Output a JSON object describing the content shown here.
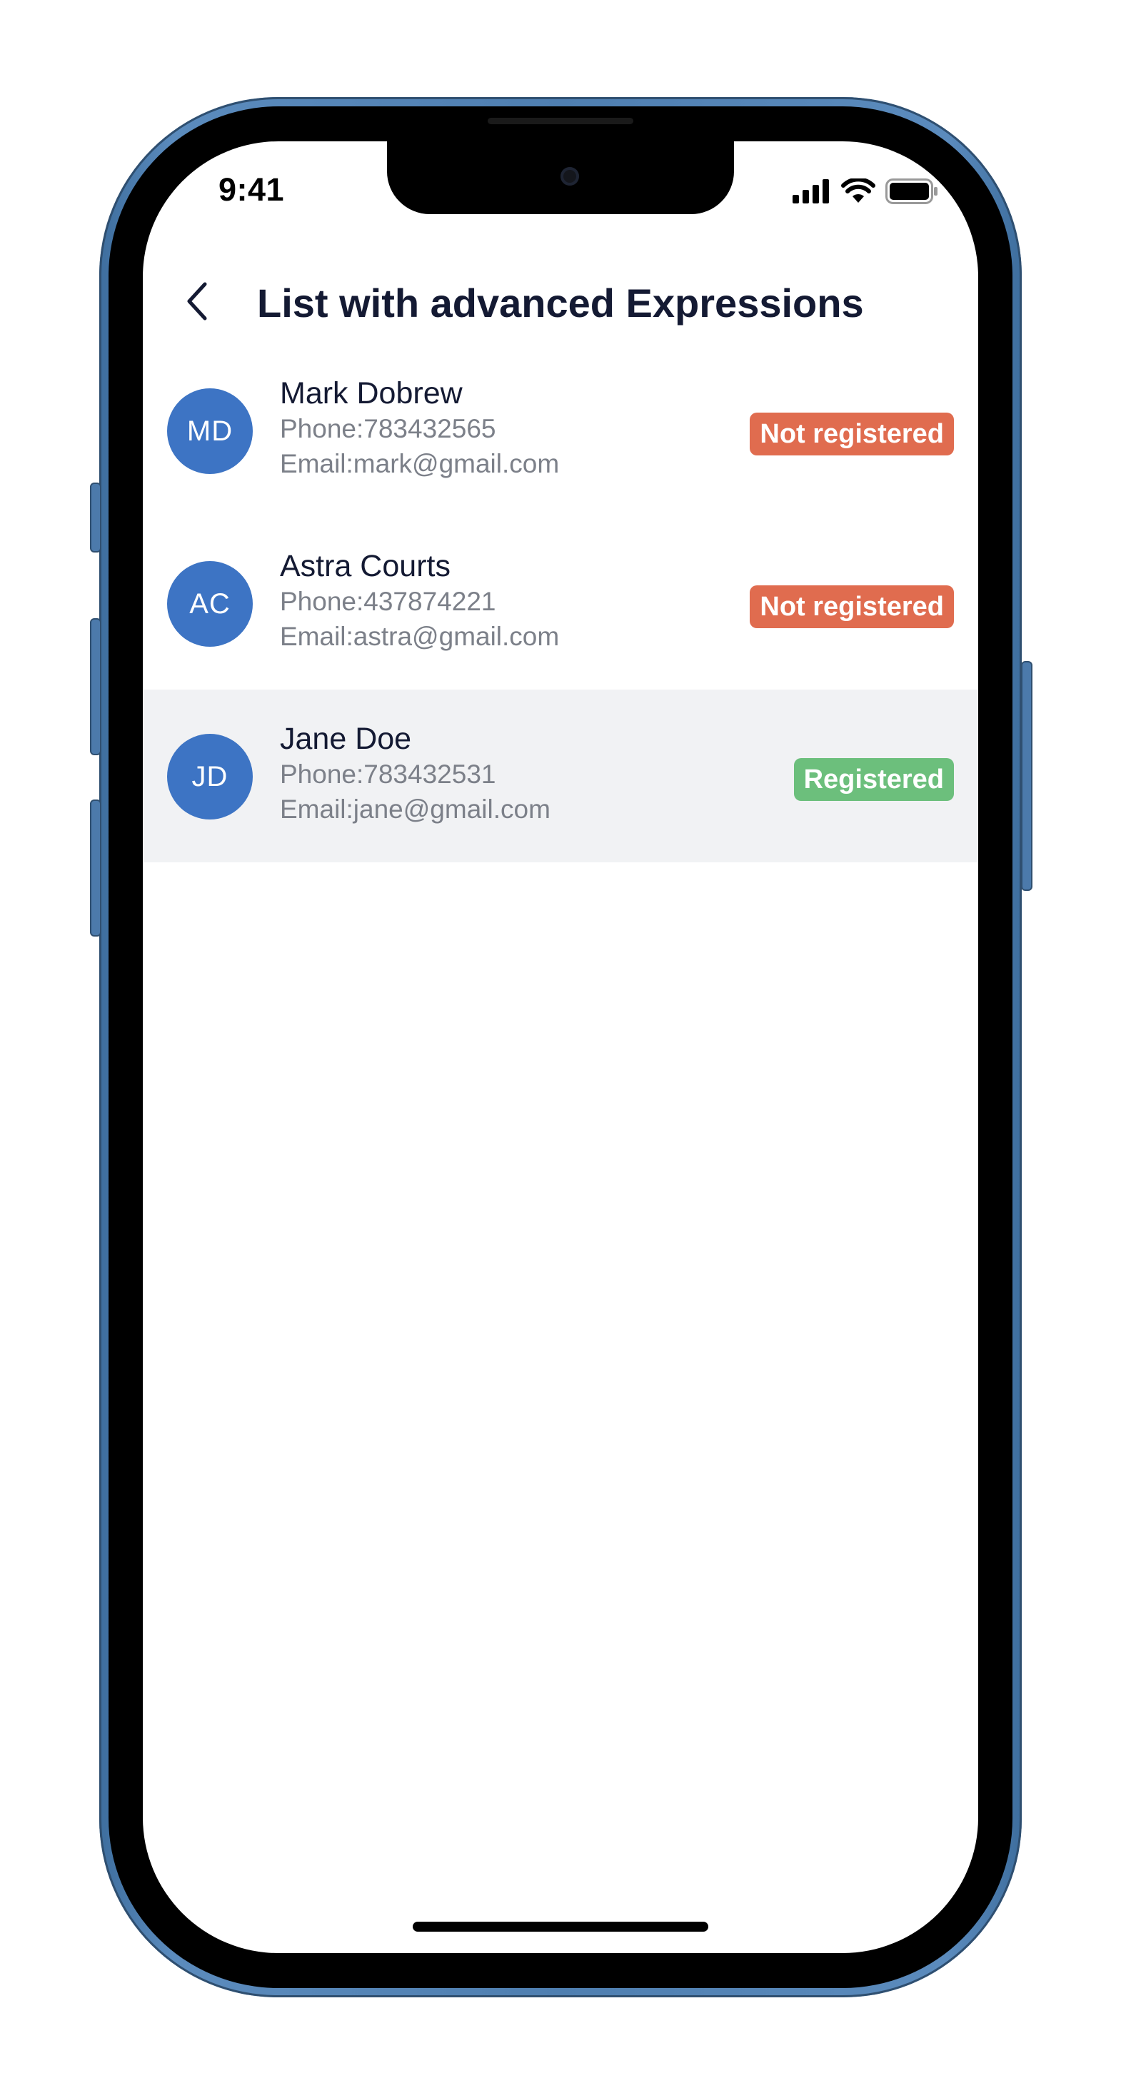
{
  "status_bar": {
    "time": "9:41"
  },
  "header": {
    "title": "List with advanced Expressions"
  },
  "contacts": [
    {
      "initials": "MD",
      "name": "Mark Dobrew",
      "phone": "Phone:783432565",
      "email": "Email:mark@gmail.com",
      "status": "Not registered",
      "status_color": "#e06c4f",
      "selected": false
    },
    {
      "initials": "AC",
      "name": "Astra Courts",
      "phone": "Phone:437874221",
      "email": "Email:astra@gmail.com",
      "status": "Not registered",
      "status_color": "#e06c4f",
      "selected": false
    },
    {
      "initials": "JD",
      "name": "Jane Doe",
      "phone": "Phone:783432531",
      "email": "Email:jane@gmail.com",
      "status": "Registered",
      "status_color": "#6cbf7c",
      "selected": true
    }
  ],
  "colors": {
    "avatar": "#3d74c4",
    "title": "#141a33",
    "secondary_text": "#7c8089",
    "selected_row": "#f1f2f4",
    "frame": "#4f7fb1"
  },
  "icons": {
    "back": "chevron-left-icon",
    "signal": "cellular-signal-icon",
    "wifi": "wifi-icon",
    "battery": "battery-icon"
  }
}
